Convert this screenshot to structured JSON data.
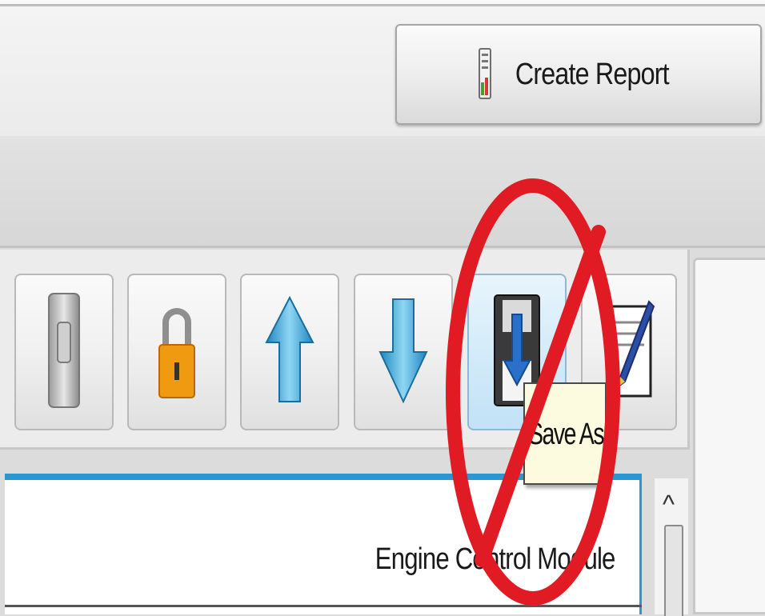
{
  "header": {
    "create_report_label": "Create Report",
    "create_report_icon": "report-document-icon"
  },
  "toolbar": {
    "buttons": [
      {
        "icon": "switch-icon"
      },
      {
        "icon": "padlock-icon"
      },
      {
        "icon": "arrow-up-icon"
      },
      {
        "icon": "arrow-down-icon"
      },
      {
        "icon": "save-as-disk-icon"
      },
      {
        "icon": "edit-document-icon"
      }
    ],
    "tooltip": "Save As"
  },
  "list": {
    "items": [
      "Engine Control Module"
    ]
  },
  "scrollbar": {
    "up_arrow": "^"
  },
  "annotation": {
    "icon": "prohibited-sign-icon",
    "color": "#e01b24"
  },
  "colors": {
    "accent": "#2a96d2",
    "tooltip_bg": "#fcfadf",
    "lock_body": "#f09a12",
    "arrow": "#36a8d8"
  }
}
